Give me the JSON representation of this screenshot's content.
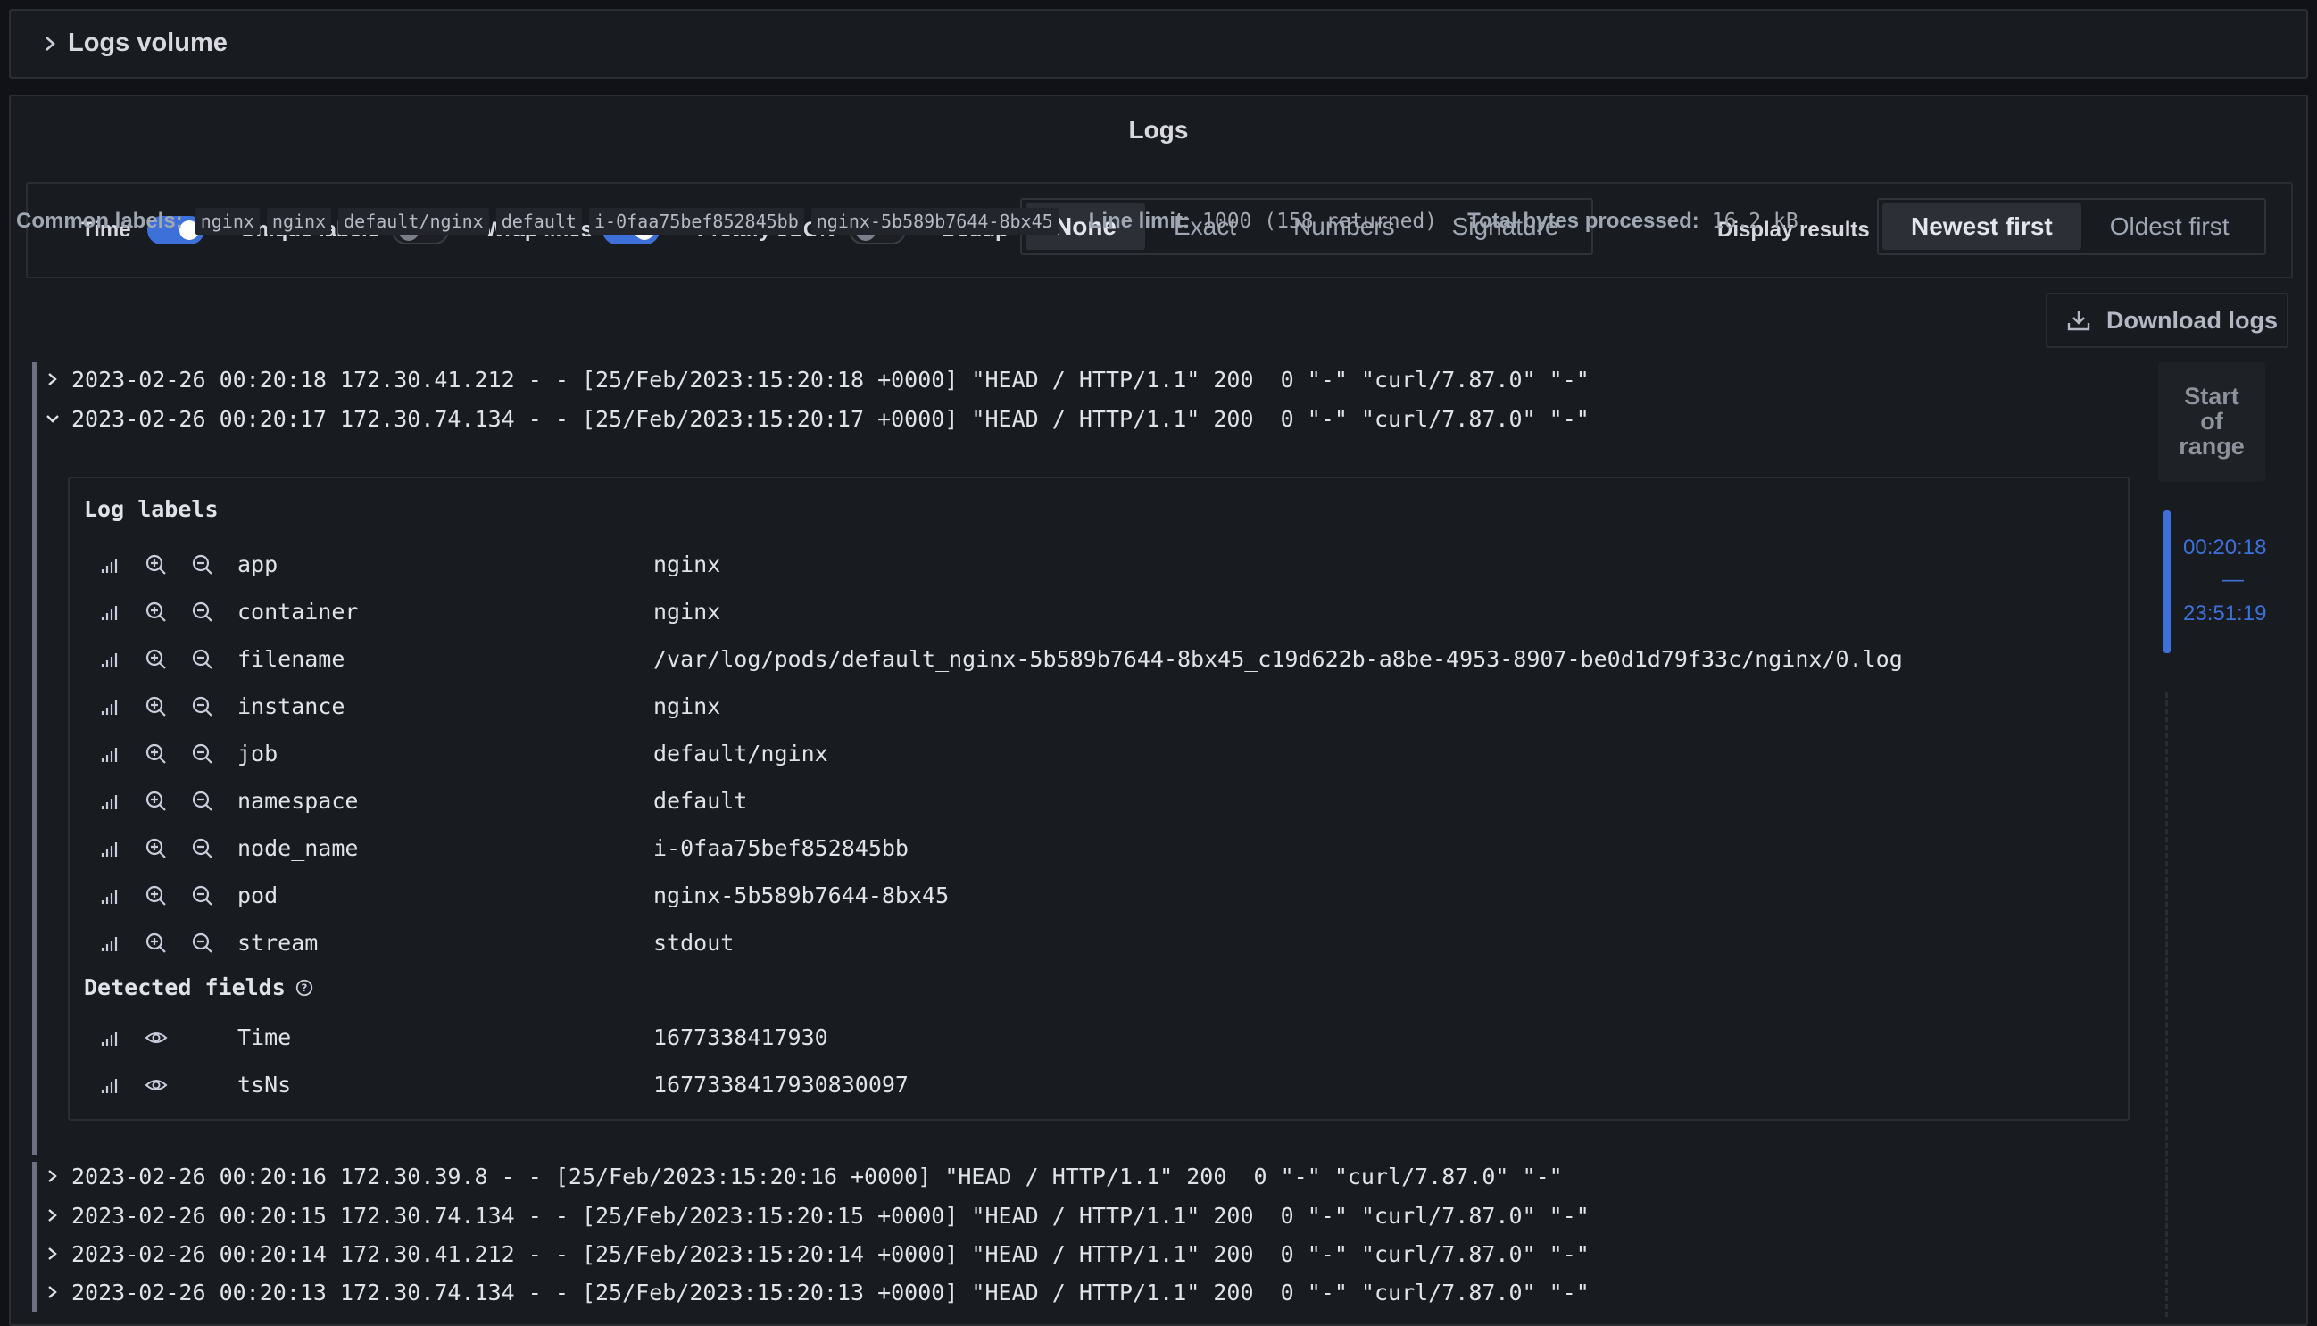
{
  "logs_volume": {
    "title": "Logs volume",
    "icon": "chevron-right-icon"
  },
  "logs_panel": {
    "title": "Logs"
  },
  "options": {
    "time": {
      "label": "Time",
      "on": true
    },
    "unique_labels": {
      "label": "Unique labels",
      "on": false
    },
    "wrap_lines": {
      "label": "Wrap lines",
      "on": true
    },
    "prettify_json": {
      "label": "Prettify JSON",
      "on": false
    },
    "dedup": {
      "label": "Dedup",
      "options": [
        "None",
        "Exact",
        "Numbers",
        "Signature"
      ],
      "selected": "None"
    },
    "display_results": {
      "label": "Display results",
      "options": [
        "Newest first",
        "Oldest first"
      ],
      "selected": "Newest first"
    }
  },
  "meta": {
    "common_labels_key": "Common labels:",
    "common_labels": [
      "nginx",
      "nginx",
      "default/nginx",
      "default",
      "i-0faa75bef852845bb",
      "nginx-5b589b7644-8bx45"
    ],
    "line_limit_key": "Line limit:",
    "line_limit_value": "1000 (158 returned)",
    "total_bytes_key": "Total bytes processed:",
    "total_bytes_value": "16.2 kB"
  },
  "download": {
    "label": "Download logs",
    "icon": "download-icon"
  },
  "log_lines": [
    {
      "text": "2023-02-26 00:20:18 172.30.41.212 - - [25/Feb/2023:15:20:18 +0000] \"HEAD / HTTP/1.1\" 200  0 \"-\" \"curl/7.87.0\" \"-\"",
      "expanded": false
    },
    {
      "text": "2023-02-26 00:20:17 172.30.74.134 - - [25/Feb/2023:15:20:17 +0000] \"HEAD / HTTP/1.1\" 200  0 \"-\" \"curl/7.87.0\" \"-\"",
      "expanded": true
    },
    {
      "text": "2023-02-26 00:20:16 172.30.39.8 - - [25/Feb/2023:15:20:16 +0000] \"HEAD / HTTP/1.1\" 200  0 \"-\" \"curl/7.87.0\" \"-\"",
      "expanded": false
    },
    {
      "text": "2023-02-26 00:20:15 172.30.74.134 - - [25/Feb/2023:15:20:15 +0000] \"HEAD / HTTP/1.1\" 200  0 \"-\" \"curl/7.87.0\" \"-\"",
      "expanded": false
    },
    {
      "text": "2023-02-26 00:20:14 172.30.41.212 - - [25/Feb/2023:15:20:14 +0000] \"HEAD / HTTP/1.1\" 200  0 \"-\" \"curl/7.87.0\" \"-\"",
      "expanded": false
    },
    {
      "text": "2023-02-26 00:20:13 172.30.74.134 - - [25/Feb/2023:15:20:13 +0000] \"HEAD / HTTP/1.1\" 200  0 \"-\" \"curl/7.87.0\" \"-\"",
      "expanded": false
    }
  ],
  "details": {
    "labels_title": "Log labels",
    "labels": [
      {
        "key": "app",
        "value": "nginx"
      },
      {
        "key": "container",
        "value": "nginx"
      },
      {
        "key": "filename",
        "value": "/var/log/pods/default_nginx-5b589b7644-8bx45_c19d622b-a8be-4953-8907-be0d1d79f33c/nginx/0.log"
      },
      {
        "key": "instance",
        "value": "nginx"
      },
      {
        "key": "job",
        "value": "default/nginx"
      },
      {
        "key": "namespace",
        "value": "default"
      },
      {
        "key": "node_name",
        "value": "i-0faa75bef852845bb"
      },
      {
        "key": "pod",
        "value": "nginx-5b589b7644-8bx45"
      },
      {
        "key": "stream",
        "value": "stdout"
      }
    ],
    "fields_title": "Detected fields",
    "fields": [
      {
        "key": "Time",
        "value": "1677338417930"
      },
      {
        "key": "tsNs",
        "value": "1677338417930830097"
      }
    ]
  },
  "range": {
    "start_label": [
      "Start",
      "of",
      "range"
    ],
    "from": "00:20:18",
    "separator": "—",
    "to": "23:51:19"
  },
  "colors": {
    "accent": "#3d71d9",
    "background": "#111217",
    "panel": "#181b1f"
  }
}
